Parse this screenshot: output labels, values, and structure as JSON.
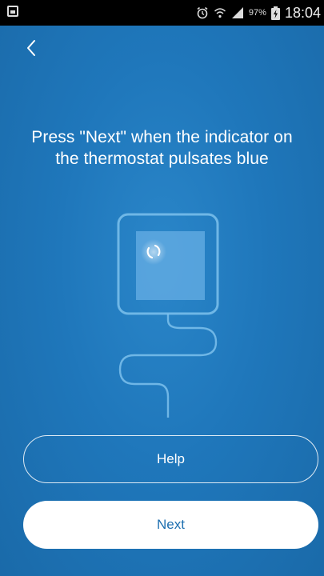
{
  "status_bar": {
    "battery_percent": "97%",
    "time": "18:04",
    "icons": [
      "gallery-notification-icon",
      "alarm-icon",
      "wifi-icon",
      "signal-icon",
      "battery-charging-icon"
    ]
  },
  "nav": {
    "back_icon": "chevron-left-icon"
  },
  "instruction": {
    "text": "Press \"Next\" when the indicator on\nthe thermostat pulsates blue"
  },
  "illustration": {
    "icon": "thermostat-icon",
    "indicator": "pulsing-indicator-icon"
  },
  "buttons": {
    "help_label": "Help",
    "next_label": "Next"
  },
  "colors": {
    "background": "#1f77bb",
    "next_text": "#1d6fb0",
    "illustration_stroke": "#7cc1ec"
  }
}
